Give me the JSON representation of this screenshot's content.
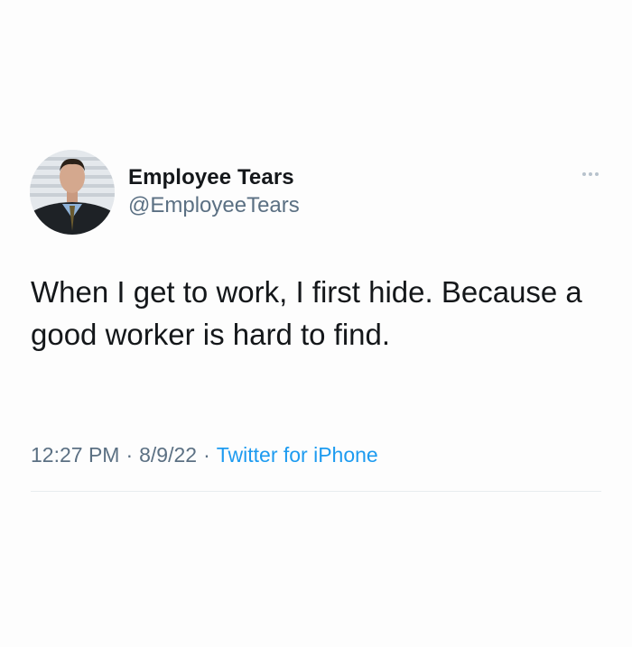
{
  "tweet": {
    "author": {
      "display_name": "Employee Tears",
      "handle": "@EmployeeTears",
      "avatar_icon": "profile-avatar"
    },
    "more_icon": "more-options-icon",
    "text": "When I get to work, I first hide. Because a good worker is hard to find.",
    "time": "12:27 PM",
    "separator": "·",
    "date": "8/9/22",
    "source": "Twitter for iPhone"
  },
  "colors": {
    "text": "#14171a",
    "secondary": "#5b7083",
    "link": "#1d9bf0",
    "divider": "#e8ecef"
  }
}
